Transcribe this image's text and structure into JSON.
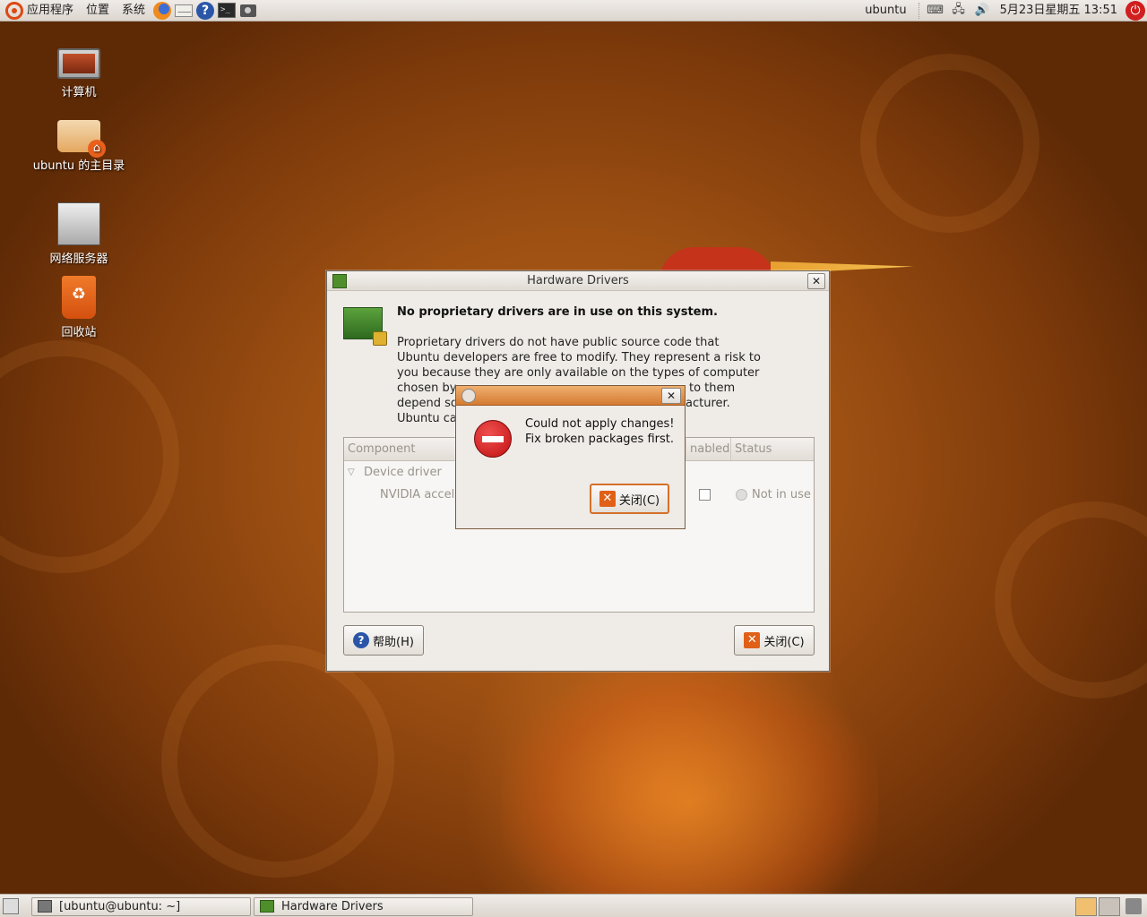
{
  "top_panel": {
    "menus": [
      "应用程序",
      "位置",
      "系统"
    ],
    "user": "ubuntu",
    "datetime": "5月23日星期五 13:51"
  },
  "desktop_icons": [
    {
      "label": "计算机"
    },
    {
      "label": "ubuntu 的主目录"
    },
    {
      "label": "网络服务器"
    },
    {
      "label": "回收站"
    }
  ],
  "hw_dialog": {
    "title": "Hardware Drivers",
    "heading": "No proprietary drivers are in use on this system.",
    "description_lines": [
      "Proprietary drivers do not have public source code that",
      "Ubuntu developers are free to modify. They represent a risk to",
      "you because they are only available on the types of computer",
      "chosen by",
      "depend so",
      "Ubuntu ca"
    ],
    "description_tail": [
      " to them",
      "acturer."
    ],
    "columns": {
      "component": "Component",
      "enabled": "nabled",
      "status": "Status"
    },
    "tree": {
      "group": "Device driver",
      "item": "NVIDIA accele",
      "item_status": "Not in use"
    },
    "help_label": "帮助(H)",
    "close_label": "关闭(C)"
  },
  "error_dialog": {
    "line1": "Could not apply changes!",
    "line2": "Fix broken packages first.",
    "close_label": "关闭(C)"
  },
  "taskbar": {
    "tasks": [
      "[ubuntu@ubuntu: ~]",
      "Hardware Drivers"
    ]
  },
  "colors": {
    "ubuntu_orange": "#dd4814",
    "panel_bg": "#e6e1db",
    "dialog_bg": "#efebe7"
  }
}
